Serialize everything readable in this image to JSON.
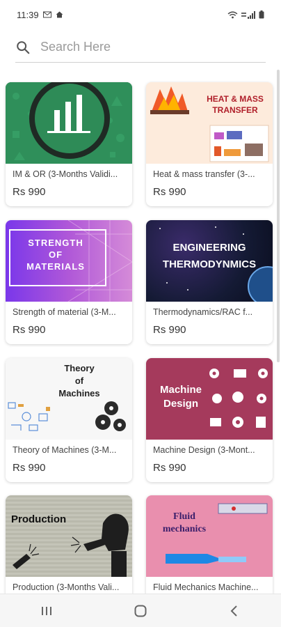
{
  "status_bar": {
    "time": "11:39"
  },
  "search": {
    "placeholder": "Search Here"
  },
  "courses": [
    {
      "title": "IM & OR  (3-Months Validi...",
      "price": "Rs 990"
    },
    {
      "title": "Heat & mass transfer  (3-...",
      "price": "Rs 990",
      "thumb_text": [
        "HEAT & MASS",
        "TRANSFER"
      ]
    },
    {
      "title": "Strength of material (3-M...",
      "price": "Rs 990",
      "thumb_text": [
        "STRENGTH",
        "OF",
        "MATERIALS"
      ]
    },
    {
      "title": "Thermodynamics/RAC f...",
      "price": "Rs 990",
      "thumb_text": [
        "ENGINEERING",
        "THERMODYNMICS"
      ]
    },
    {
      "title": "Theory of Machines (3-M...",
      "price": "Rs 990",
      "thumb_text": [
        "Theory",
        "of",
        "Machines"
      ]
    },
    {
      "title": "Machine Design (3-Mont...",
      "price": "Rs 990",
      "thumb_text": [
        "Machine",
        "Design"
      ]
    },
    {
      "title": "Production (3-Months Vali...",
      "price": "",
      "thumb_text": [
        "Production"
      ]
    },
    {
      "title": "Fluid Mechanics Machine...",
      "price": "",
      "thumb_text": [
        "Fluid",
        "mechanics"
      ]
    }
  ],
  "colors": {
    "card1": "#2e8b57",
    "card2": "#fde8d6",
    "card3": "#7b3fe4",
    "card4": "#1b1f3a",
    "card5": "#f4f4f4",
    "card6": "#a53a5c",
    "card7": "#b9b9ac",
    "card8": "#e98fae"
  }
}
